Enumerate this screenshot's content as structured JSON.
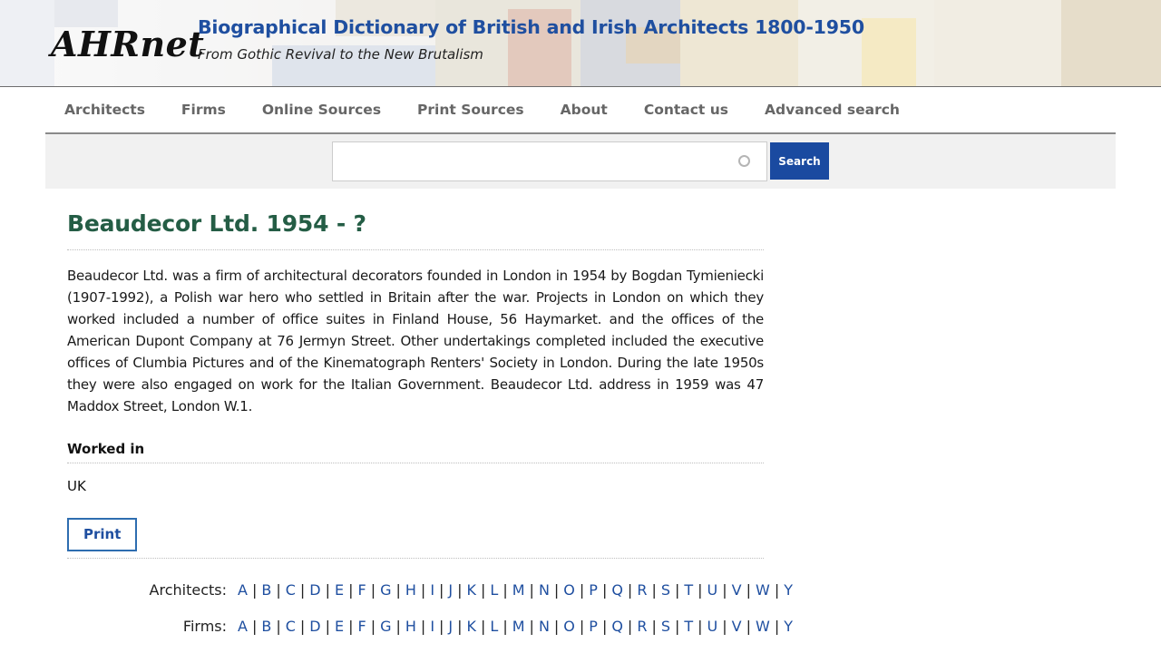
{
  "header": {
    "logo": "AHRnet",
    "title": "Biographical Dictionary of British and Irish Architects 1800-1950",
    "subtitle": "From Gothic Revival to the New Brutalism"
  },
  "nav": {
    "items": [
      "Architects",
      "Firms",
      "Online Sources",
      "Print Sources",
      "About",
      "Contact us",
      "Advanced search"
    ]
  },
  "search": {
    "value": "",
    "button_label": "Search"
  },
  "entry": {
    "title": "Beaudecor Ltd. 1954 - ?",
    "description": "Beaudecor Ltd. was a firm of architectural decorators founded in London in 1954 by Bogdan Tymieniecki (1907-1992), a Polish war hero who settled in Britain after the war.  Projects in London on which they worked included a number of office suites in Finland House, 56 Haymarket. and the offices of the American Dupont Company at 76 Jermyn Street. Other undertakings completed included the executive offices of Clumbia Pictures and of the Kinematograph Renters' Society in London. During the late 1950s they were also engaged on work for the Italian Government. Beaudecor Ltd. address in 1959 was 47 Maddox Street, London W.1.",
    "worked_in_label": "Worked in",
    "worked_in_value": "UK",
    "print_label": "Print"
  },
  "index": {
    "architects_label": "Architects:",
    "firms_label": "Firms:",
    "letters": [
      "A",
      "B",
      "C",
      "D",
      "E",
      "F",
      "G",
      "H",
      "I",
      "J",
      "K",
      "L",
      "M",
      "N",
      "O",
      "P",
      "Q",
      "R",
      "S",
      "T",
      "U",
      "V",
      "W",
      "Y"
    ]
  },
  "colors": {
    "title_blue": "#1f4fa0",
    "heading_green": "#245d45",
    "search_button": "#1a4aa0",
    "nav_text": "#666666"
  }
}
